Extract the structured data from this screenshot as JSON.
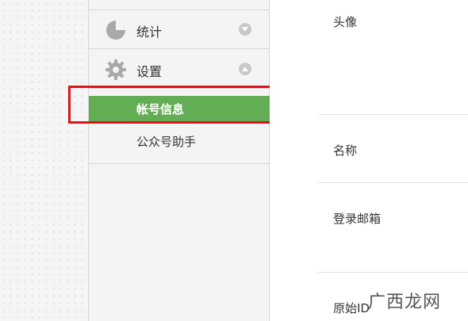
{
  "sidebar": {
    "items": [
      {
        "label": "统计",
        "icon": "pie-chart-icon",
        "toggle_icon": "chevron-down-icon"
      },
      {
        "label": "设置",
        "icon": "gear-icon",
        "toggle_icon": "chevron-up-icon"
      }
    ],
    "submenu": [
      {
        "label": "帐号信息",
        "active": true
      },
      {
        "label": "公众号助手",
        "active": false
      }
    ]
  },
  "main": {
    "fields": [
      {
        "label": "头像"
      },
      {
        "label": "名称"
      },
      {
        "label": "登录邮箱"
      },
      {
        "label": "原始ID"
      }
    ]
  },
  "watermark": {
    "text": "广西龙网"
  },
  "colors": {
    "active_bg": "#63ad54",
    "highlight_border": "#d8161c"
  }
}
